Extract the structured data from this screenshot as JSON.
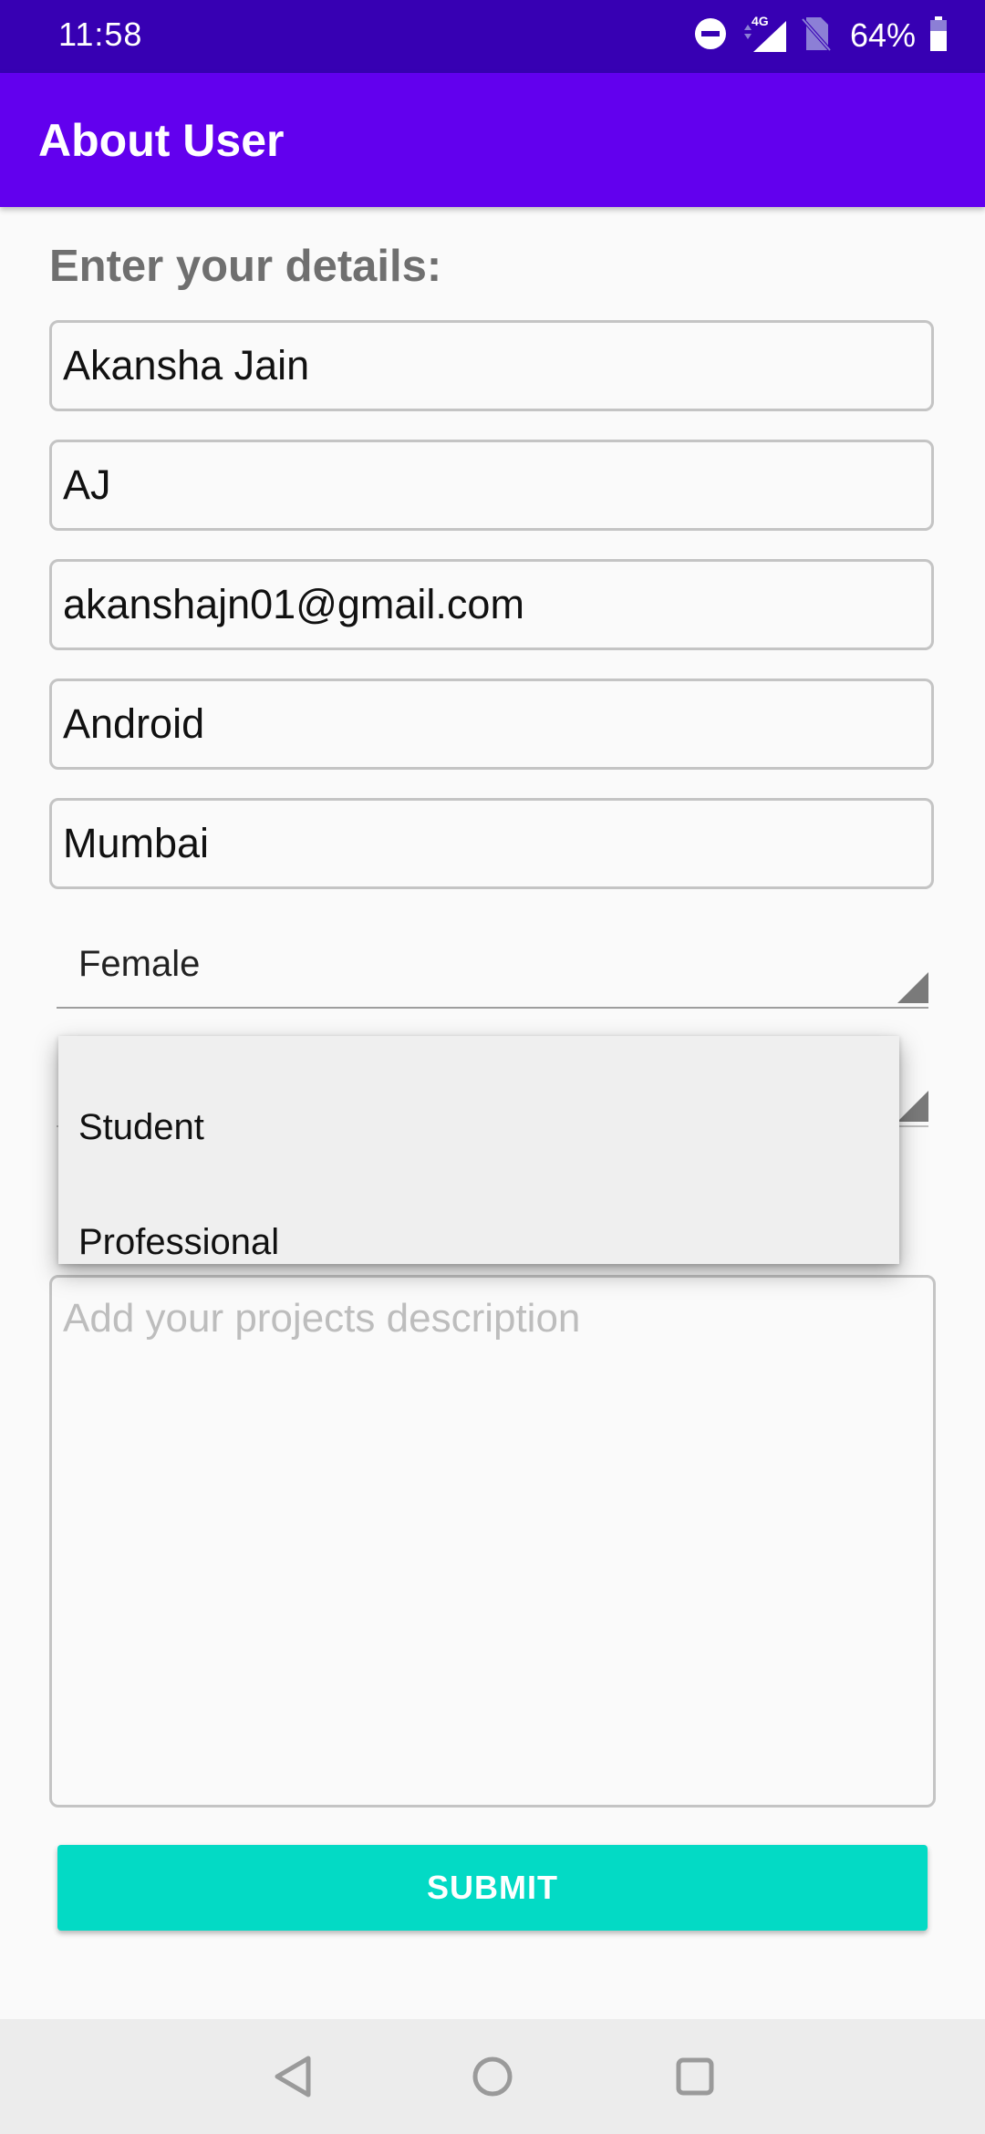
{
  "status_bar": {
    "time": "11:58",
    "network_label": "4G",
    "battery": "64%",
    "icons": [
      "do-not-disturb-icon",
      "cellular-signal-icon",
      "no-sim-icon",
      "battery-icon"
    ]
  },
  "app_bar": {
    "title": "About User"
  },
  "form": {
    "heading": "Enter your details:",
    "fields": [
      {
        "value": "Akansha Jain"
      },
      {
        "value": "AJ"
      },
      {
        "value": "akanshajn01@gmail.com"
      },
      {
        "value": "Android"
      },
      {
        "value": "Mumbai"
      }
    ],
    "gender_spinner": {
      "selected": "Female"
    },
    "occupation_dropdown": {
      "options": [
        "Student",
        "Professional"
      ]
    },
    "description": {
      "value": "",
      "placeholder": "Add your projects description"
    },
    "submit_label": "SUBMIT"
  },
  "colors": {
    "status_bar": "#3700b3",
    "app_bar": "#6200ee",
    "accent": "#03dac5",
    "background": "#fafafa"
  },
  "nav_bar": {
    "icons": [
      "back-icon",
      "home-icon",
      "recents-icon"
    ]
  }
}
